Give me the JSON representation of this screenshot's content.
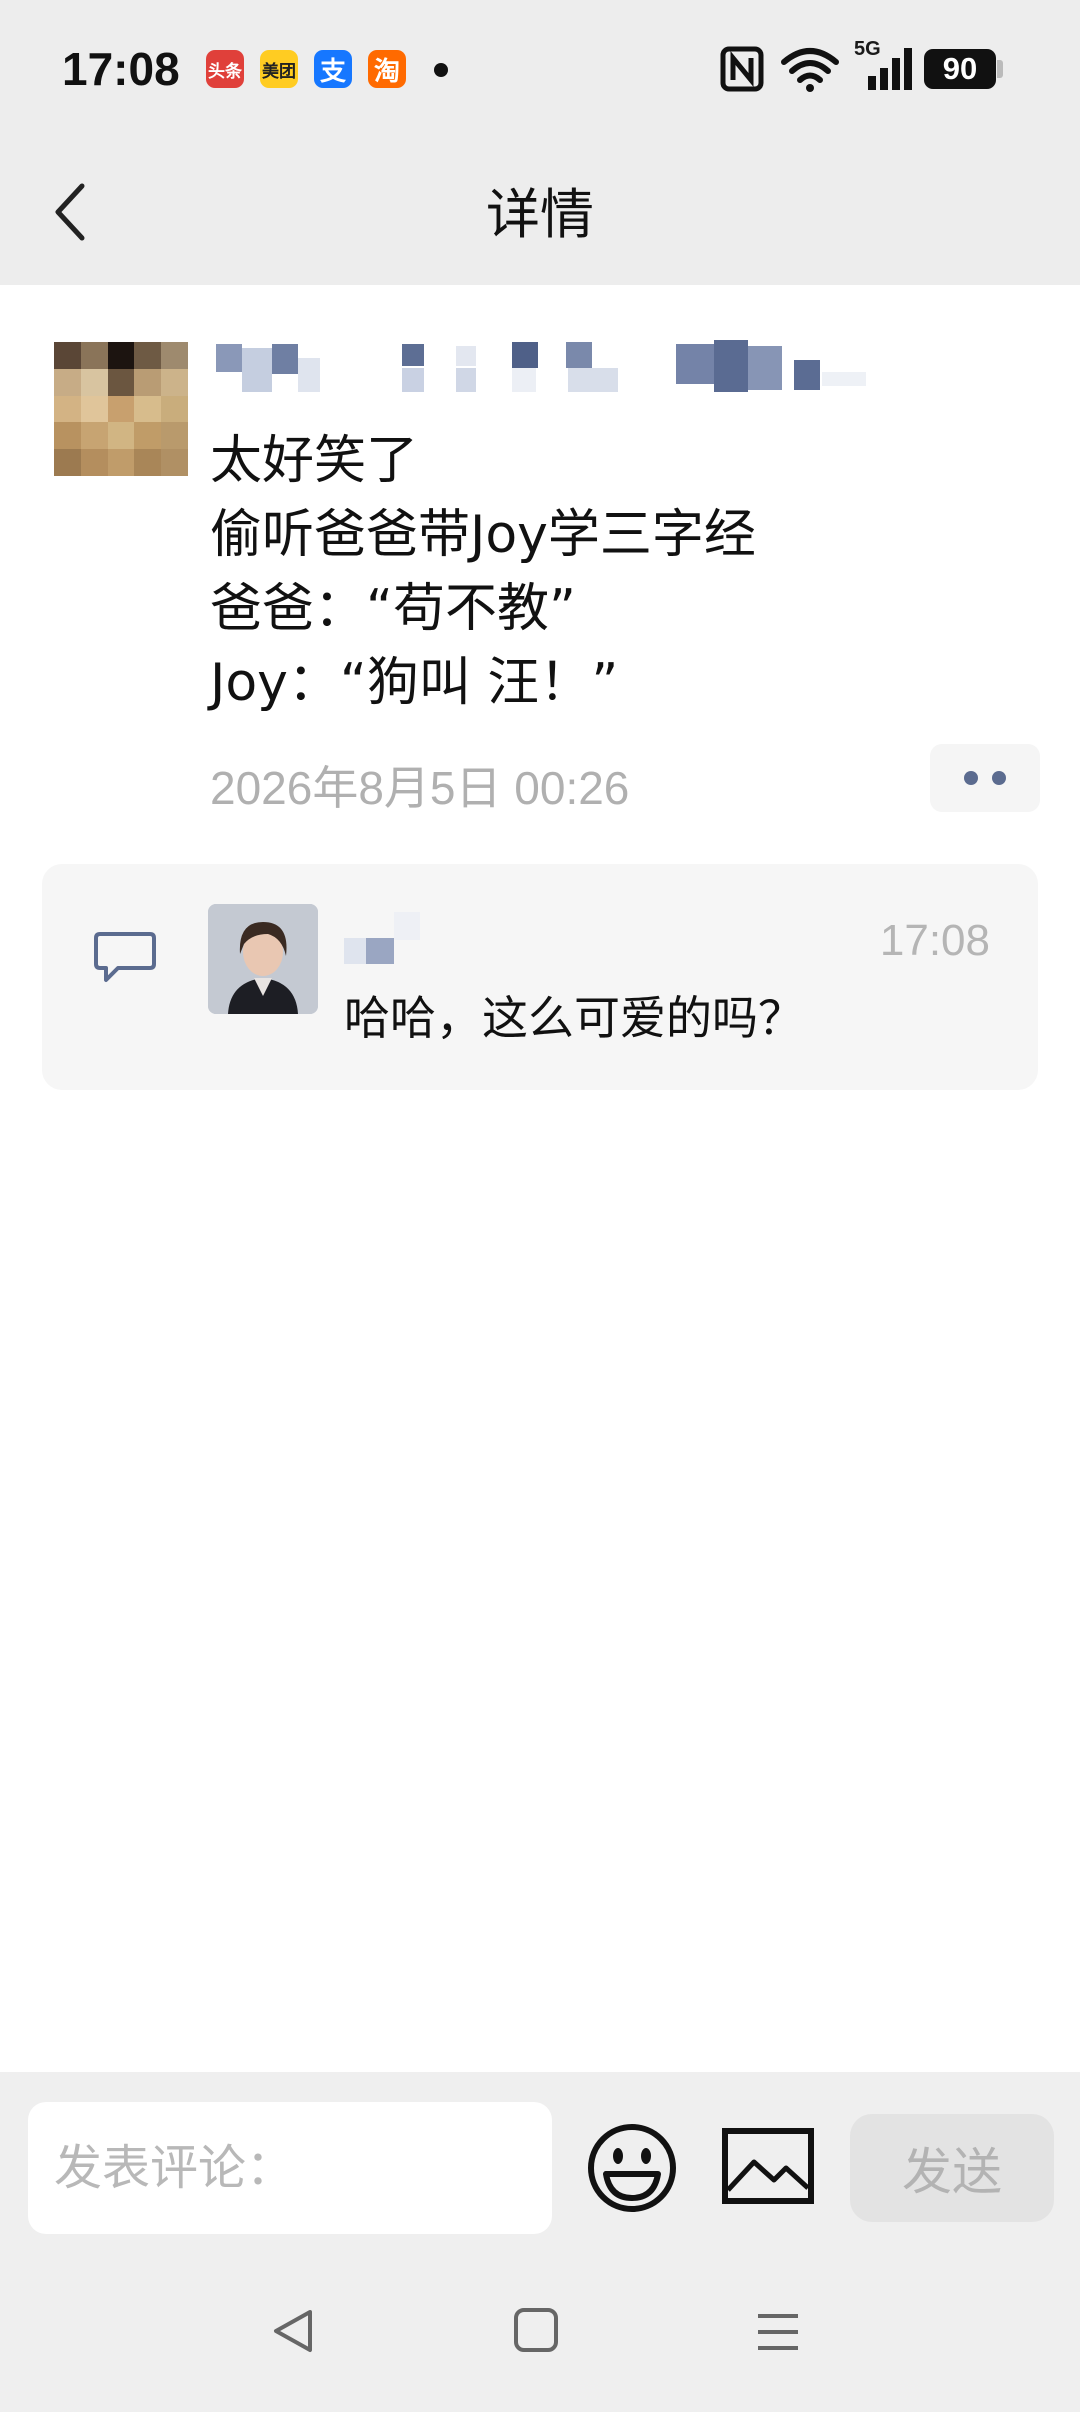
{
  "status_bar": {
    "time": "17:08",
    "apps": [
      {
        "name": "toutiao",
        "label": "头条",
        "color": "#e0403a"
      },
      {
        "name": "meituan",
        "label": "美团",
        "color": "#ffcc22"
      },
      {
        "name": "alipay",
        "label": "支",
        "color": "#1677ff"
      },
      {
        "name": "taobao",
        "label": "淘",
        "color": "#ff6a00"
      }
    ],
    "network": "5G",
    "battery": "90"
  },
  "header": {
    "title": "详情",
    "back_icon": "chevron-left-icon"
  },
  "post": {
    "lines": [
      "太好笑了",
      "偷听爸爸带Joy学三字经",
      "爸爸：“苟不教”",
      "Joy：“狗叫 汪！”"
    ],
    "timestamp": "2026年8月5日 00:26",
    "more_icon": "more-dots-icon"
  },
  "comment": {
    "time": "17:08",
    "text": "哈哈，这么可爱的吗？",
    "icon": "comment-bubble-icon"
  },
  "composer": {
    "placeholder": "发表评论：",
    "emoji_icon": "emoji-icon",
    "image_icon": "image-icon",
    "send_label": "发送"
  },
  "nav": {
    "back_icon": "triangle-back-icon",
    "home_icon": "square-home-icon",
    "menu_icon": "menu-lines-icon"
  },
  "colors": {
    "bar_background": "#ededed",
    "accent_icon": "#5b6b8f",
    "muted_text": "#b0b0b0"
  }
}
